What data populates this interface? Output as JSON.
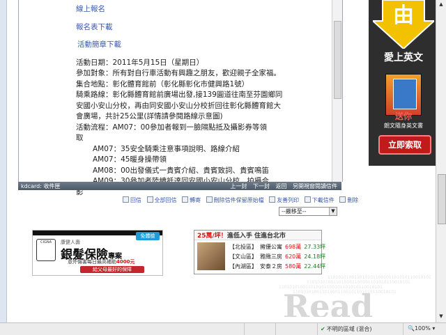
{
  "mail": {
    "links": {
      "online_signup": "線上報名",
      "form_download": "報名表下載",
      "activity_brief_download": "活動簡章下載"
    },
    "lines": {
      "date": "活動日期：2011年5月15日（星期日）",
      "participants": "參加對象：所有對自行車活動有興趣之朋友，歡迎親子全家福。",
      "meet_place": "集合地點：彰化體育館前（彰化縣彰化市健興路1號）",
      "route_1": "騎乘路線：彰化縣體育館前廣場出發,接139圓道往南至芬園鄉同",
      "route_2": "安國小安山分校，再由同安國小安山分校折回往彰化縣體育館大",
      "route_3": "會廣場，共計25公里(詳情請參閱路線示意圖)",
      "flow_1": "活動流程：AM07：00參加者報到一臉隔點抵及攝影券等領",
      "flow_2": "取"
    },
    "schedule": [
      "AM07：35安全騎乘注意事項說明、路線介紹",
      "AM07：45暖身操帶領",
      "AM08：00出發儀式一貴賓介紹、貴賓致詞、貴賓鳴笛",
      "AM09：30參加者陸續抵達同安國小安山分校、拍攝合"
    ],
    "schedule_tail": "影"
  },
  "mailbar": {
    "label": "kdcard: 收件匣",
    "nav": [
      "上一封",
      "下一封",
      "返回",
      "另開視窗閱讀信件"
    ]
  },
  "actions": [
    "回信",
    "全部回信",
    "轉寄",
    "刪除信件保留原始檔",
    "友善列印",
    "下載信件",
    "刪除"
  ],
  "move_select": "--搬移至--",
  "side_ad": {
    "big_char": "由",
    "headline": "愛上英文",
    "sub1": "送你",
    "sub2": "朗文隨身英文書",
    "button": "立即索取",
    "accent": "#f2c200"
  },
  "insurance_ad": {
    "company": "康健人壽",
    "logo": "CIGNA",
    "name": "銀髮保險",
    "name_suffix": "專案",
    "badge": "免體檢",
    "detail": "意外傷害每日最高補助",
    "amount": "4000元",
    "cta": "給父母最好的保障"
  },
  "house_ad": {
    "headline_price": "25萬/坪！",
    "headline_text": "進低入手 住進台北市",
    "rows": [
      {
        "area": "【北投區】",
        "name": "擁優公寓",
        "price": "698萬",
        "size": "27.33坪"
      },
      {
        "area": "【文山區】",
        "name": "雅緻三房",
        "price": "620萬",
        "size": "24.18坪"
      },
      {
        "area": "【內湖區】",
        "name": "安泰２房",
        "price": "580萬",
        "size": "22.44坪"
      }
    ]
  },
  "deco": {
    "bits": "110101010011010101100101101010110010101",
    "word": "Read"
  },
  "statusbar": {
    "zone": "不明的區域 (混合)",
    "zoom": "100%"
  }
}
